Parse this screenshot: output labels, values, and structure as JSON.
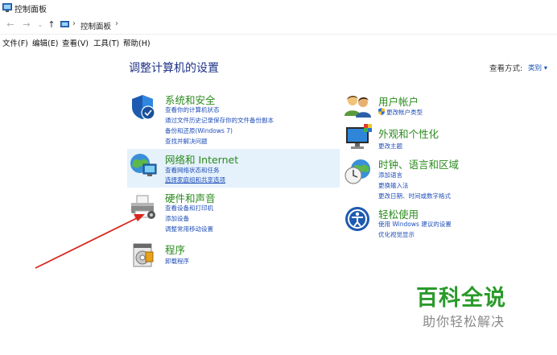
{
  "window": {
    "title": "控制面板"
  },
  "address": {
    "crumb": "控制面板"
  },
  "menu": [
    "文件(F)",
    "编辑(E)",
    "查看(V)",
    "工具(T)",
    "帮助(H)"
  ],
  "heading": "调整计算机的设置",
  "view_by": {
    "label": "查看方式:",
    "value": "类别 ▾"
  },
  "categories": [
    {
      "title": "系统和安全",
      "icon": "shield-icon",
      "links": [
        "查看你的计算机状态",
        "通过文件历史记录保存你的文件备份副本",
        "备份和还原(Windows 7)",
        "查找并解决问题"
      ]
    },
    {
      "title": "网络和 Internet",
      "icon": "globe-network-icon",
      "links": [
        "查看网络状态和任务",
        "选择家庭组和共享选项"
      ]
    },
    {
      "title": "硬件和声音",
      "icon": "printer-icon",
      "links": [
        "查看设备和打印机",
        "添加设备",
        "调整常用移动设置"
      ]
    },
    {
      "title": "程序",
      "icon": "program-icon",
      "links": [
        "卸载程序"
      ]
    },
    {
      "title": "用户帐户",
      "icon": "users-icon",
      "links": [
        "更改帐户类型"
      ]
    },
    {
      "title": "外观和个性化",
      "icon": "monitor-icon",
      "links": [
        "更改主题"
      ]
    },
    {
      "title": "时钟、语言和区域",
      "icon": "clock-globe-icon",
      "links": [
        "添加语言",
        "更换输入法",
        "更改日期、时间或数字格式"
      ]
    },
    {
      "title": "轻松使用",
      "icon": "ease-of-access-icon",
      "links": [
        "使用 Windows 建议的设置",
        "优化视觉显示"
      ]
    }
  ],
  "watermark": {
    "main": "百科全说",
    "sub": "助你轻松解决"
  },
  "colors": {
    "title_green": "#2b8a1e",
    "link_blue": "#1f4eb8",
    "heading_blue": "#1e3287",
    "hover_bg": "#e5f1fb",
    "arrow_red": "#d9261c"
  }
}
